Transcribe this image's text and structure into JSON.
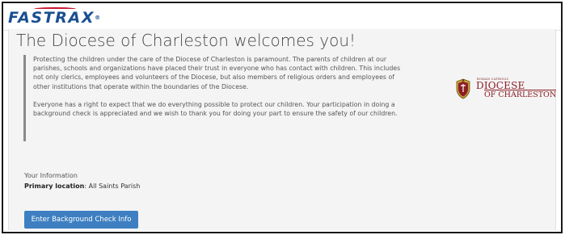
{
  "header": {
    "logo_text": "FASTRAX",
    "logo_mark": "®"
  },
  "main": {
    "title": "The Diocese of Charleston welcomes you!",
    "paragraphs": [
      "Protecting the children under the care of the Diocese of Charleston is paramount. The parents of children at our parishes, schools and organizations have placed their trust in everyone who has contact with children. This includes not only clerics, employees and volunteers of the Diocese, but also members of religious orders and employees of other institutions that operate within the boundaries of the Diocese.",
      "Everyone has a right to expect that we do everything possible to protect our children. Your participation in doing a background check is appreciated and we wish to thank you for doing your part to ensure the safety of our children."
    ]
  },
  "diocese_logo": {
    "line_small": "ROMAN CATHOLIC",
    "line_main": "DIOCESE",
    "line_sub": "OF CHARLESTON",
    "color": "#8b1d24"
  },
  "info": {
    "heading": "Your Information",
    "primary_label": "Primary location",
    "primary_sep": ":",
    "primary_value": "All Saints Parish"
  },
  "actions": {
    "background_check_label": "Enter Background Check Info",
    "accent": "#3d7fc1"
  },
  "brand": {
    "logo_blue": "#1a4f91",
    "logo_red": "#c8102e"
  }
}
